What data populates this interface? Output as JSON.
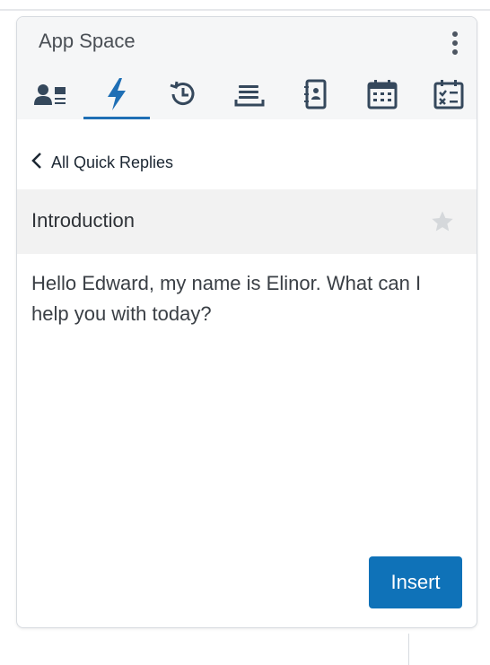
{
  "app": {
    "title": "App Space"
  },
  "tabs": [
    {
      "icon": "contact-card-icon",
      "active": false
    },
    {
      "icon": "lightning-icon",
      "active": true
    },
    {
      "icon": "history-icon",
      "active": false
    },
    {
      "icon": "list-icon",
      "active": false
    },
    {
      "icon": "address-book-icon",
      "active": false
    },
    {
      "icon": "calendar-icon",
      "active": false
    },
    {
      "icon": "checklist-icon",
      "active": false
    }
  ],
  "nav": {
    "back_label": "All Quick Replies"
  },
  "reply": {
    "title": "Introduction",
    "message": "Hello Edward, my name is Elinor. What can I help you with today?",
    "insert_label": "Insert"
  },
  "colors": {
    "accent": "#0f72b8",
    "icon": "#35485c",
    "active_icon": "#1f6fb5"
  }
}
